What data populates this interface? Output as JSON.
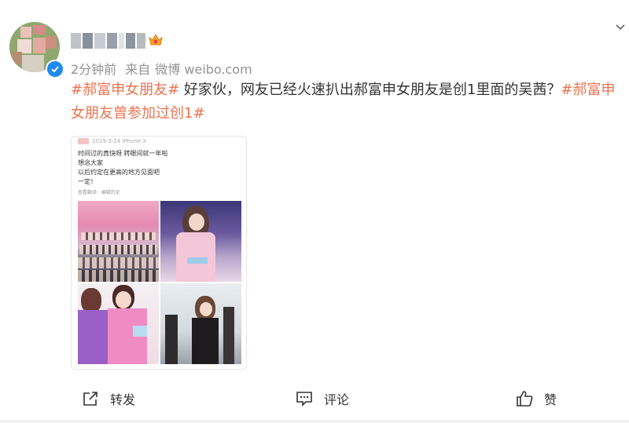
{
  "post": {
    "time": "2分钟前",
    "source_prefix": "来自",
    "source": "微博 weibo.com",
    "tag1": "#郝富申女朋友#",
    "body": " 好家伙，网友已经火速扒出郝富申女朋友是创1里面的吴茜？",
    "tag2": "#郝富申女朋友曾参加过创1#"
  },
  "card": {
    "header_date": "2019-3-24",
    "header_device": "iPhone X",
    "lines": [
      "时间过的真快呀 转眼间就一年啦",
      "想念大家",
      "以后约定在更高的地方见面吧",
      "一定！"
    ],
    "sub": "查看翻译 · 编辑历史"
  },
  "actions": {
    "repost": "转发",
    "comment": "评论",
    "like": "赞"
  },
  "icons": {
    "verify": "verified-badge-icon",
    "menu": "chevron-down-icon",
    "repost": "share-icon",
    "comment": "comment-icon",
    "like": "thumbs-up-icon"
  },
  "colors": {
    "tag": "#eb7350",
    "meta": "#939393",
    "verify": "#1d8bf0"
  }
}
